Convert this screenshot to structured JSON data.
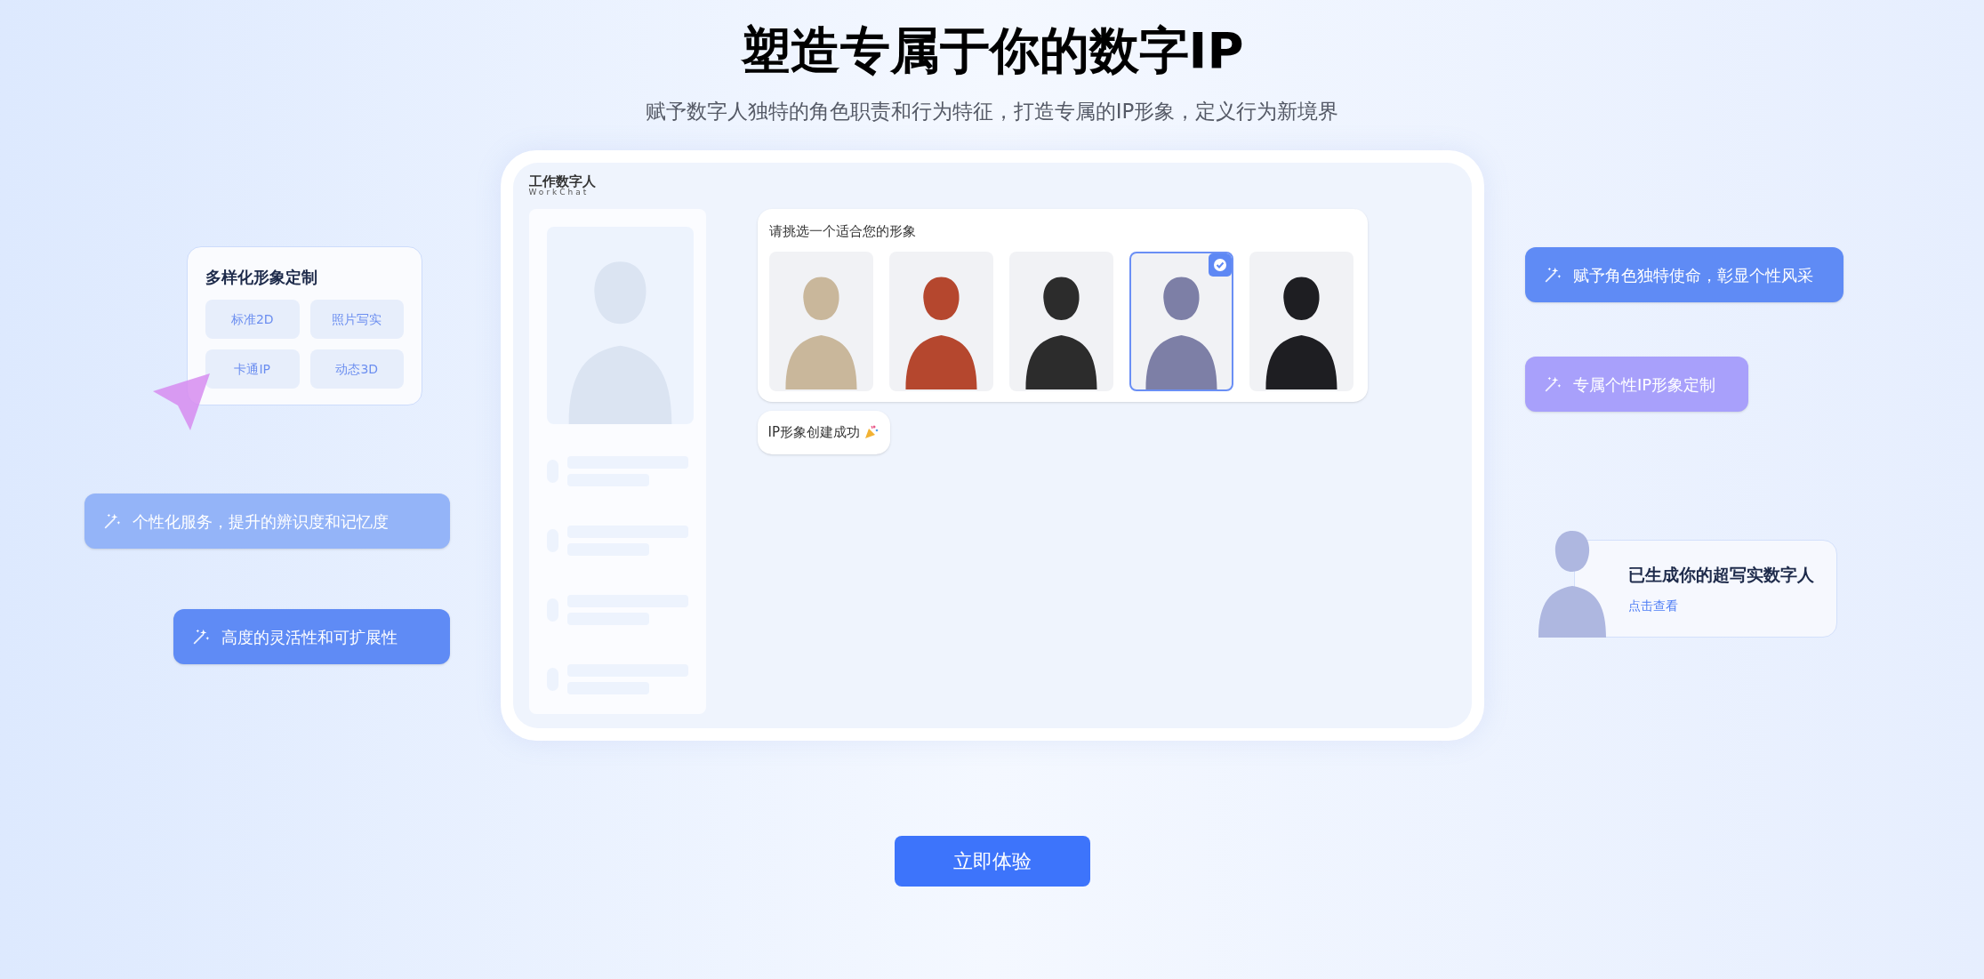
{
  "title": "塑造专属于你的数字IP",
  "subtitle": "赋予数字人独特的角色职责和行为特征，打造专属的IP形象，定义行为新境界",
  "logo": {
    "name": "工作数字人",
    "sub": "WorkChat"
  },
  "chooser": {
    "prompt": "请挑选一个适合您的形象",
    "avatars": [
      {
        "selected": false
      },
      {
        "selected": false
      },
      {
        "selected": false
      },
      {
        "selected": true
      },
      {
        "selected": false
      }
    ]
  },
  "success_message": "IP形象创建成功",
  "style_card": {
    "title": "多样化形象定制",
    "options": [
      "标准2D",
      "照片写实",
      "卡通IP",
      "动态3D"
    ]
  },
  "left_pills": [
    {
      "text": "个性化服务，提升的辨识度和记忆度",
      "color": "#94b4f8"
    },
    {
      "text": "高度的灵活性和可扩展性",
      "color": "#5f8bf5"
    }
  ],
  "right_pills": [
    {
      "text": "赋予角色独特使命，彰显个性风采",
      "color": "#5f8bf5"
    },
    {
      "text": "专属个性IP形象定制",
      "color": "#a8a0fb"
    }
  ],
  "result_card": {
    "title": "已生成你的超写实数字人",
    "link": "点击查看"
  },
  "cta": "立即体验"
}
